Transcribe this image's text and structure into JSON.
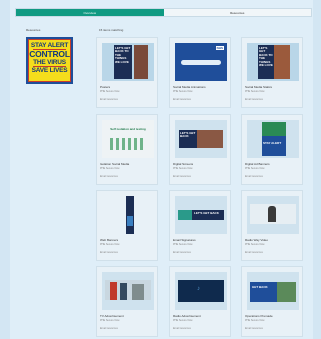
{
  "tabs": {
    "overview": "Overview",
    "resources": "Resources"
  },
  "sidebar": {
    "title": "Resources",
    "poster": {
      "line1": "STAY ALERT",
      "line2": "CONTROL",
      "line3": "THE VIRUS",
      "line4": "SAVE LIVES"
    }
  },
  "results": {
    "count_label": "15 items matching",
    "items": [
      {
        "title": "Posters",
        "meta": "PHE Secure Now",
        "link": "Email resources"
      },
      {
        "title": "Social Media Animations",
        "meta": "PHE Secure Now",
        "link": "Email resources"
      },
      {
        "title": "Social Media Statics",
        "meta": "PHE Secure Now",
        "link": "Email resources"
      },
      {
        "title": "Isolation Social Media",
        "meta": "PHE Secure Now",
        "link": "Email resources"
      },
      {
        "title": "Digital Screens",
        "meta": "PHE Secure Now",
        "link": "Email resources"
      },
      {
        "title": "Digital Ad Banners",
        "meta": "PHE Secure Now",
        "link": "Email resources"
      },
      {
        "title": "Web Banners",
        "meta": "PHE Secure Now",
        "link": "Email resources"
      },
      {
        "title": "Email Signatures",
        "meta": "PHE Secure Now",
        "link": "Email resources"
      },
      {
        "title": "Radio Way Video",
        "meta": "PHE Secure Now",
        "link": "Email resources"
      },
      {
        "title": "TV Advertisement",
        "meta": "PHE Secure Now",
        "link": "Email resources"
      },
      {
        "title": "Radio Advertisement",
        "meta": "PHE Secure Now",
        "link": "Email resources"
      },
      {
        "title": "Operations Premade",
        "meta": "PHE Secure Now",
        "link": "Email resources"
      }
    ]
  },
  "thumb_text": {
    "t0": "LET'S GET BACK TO THE THINGS WE LOVE",
    "t1": "NHS",
    "t2": "LET'S GET BACK TO THE THINGS WE LOVE",
    "t3": "Self isolation and testing",
    "t4": "LET'S GET BACK",
    "t5": "STAY ALERT",
    "t7": "LET'S GET BACK",
    "t11": "GET BACK"
  },
  "colors": {
    "accent": "#109a82",
    "navy": "#1f4e9a",
    "yellow": "#f4dd1c"
  }
}
